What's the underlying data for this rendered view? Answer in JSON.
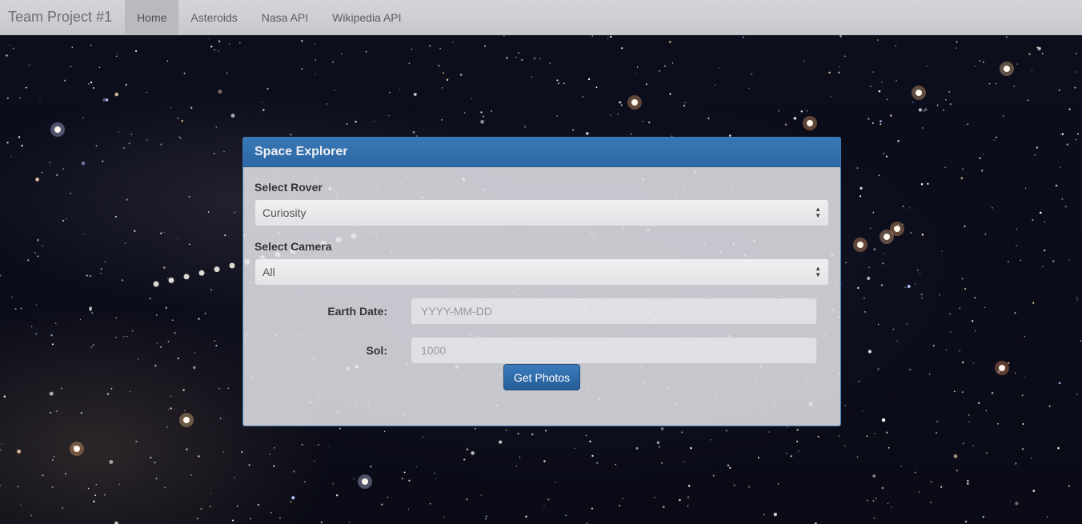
{
  "navbar": {
    "brand": "Team Project #1",
    "items": [
      {
        "label": "Home",
        "active": true
      },
      {
        "label": "Asteroids",
        "active": false
      },
      {
        "label": "Nasa API",
        "active": false
      },
      {
        "label": "Wikipedia API",
        "active": false
      }
    ]
  },
  "panel": {
    "title": "Space Explorer",
    "rover": {
      "label": "Select Rover",
      "selected": "Curiosity"
    },
    "camera": {
      "label": "Select Camera",
      "selected": "All"
    },
    "earth_date": {
      "label": "Earth Date:",
      "value": "",
      "placeholder": "YYYY-MM-DD"
    },
    "sol": {
      "label": "Sol:",
      "value": "",
      "placeholder": "1000"
    },
    "submit_label": "Get Photos"
  },
  "colors": {
    "panel_header": "#3877b5",
    "button": "#265e98",
    "navbar": "#dcdce1"
  },
  "icons": {
    "select_arrows": "updown-arrows-icon"
  }
}
